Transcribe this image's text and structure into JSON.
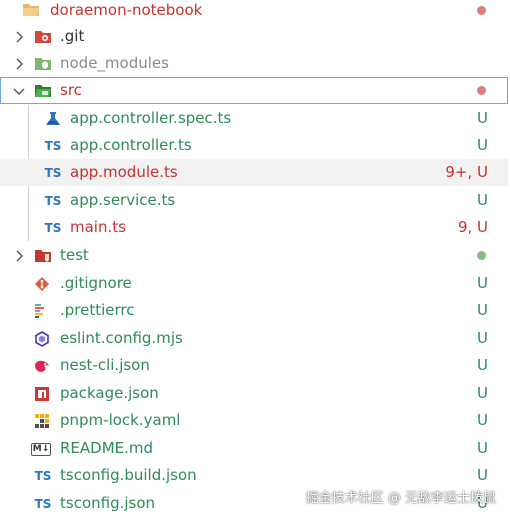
{
  "explorer": {
    "root": {
      "label": "doraemon-notebook"
    },
    "items": [
      {
        "label": ".git",
        "status": ""
      },
      {
        "label": "node_modules",
        "status": ""
      },
      {
        "label": "src",
        "status": ""
      },
      {
        "label": "app.controller.spec.ts",
        "status": "U"
      },
      {
        "label": "app.controller.ts",
        "status": "U"
      },
      {
        "label": "app.module.ts",
        "status": "9+, U"
      },
      {
        "label": "app.service.ts",
        "status": "U"
      },
      {
        "label": "main.ts",
        "status": "9, U"
      },
      {
        "label": "test",
        "status": ""
      },
      {
        "label": ".gitignore",
        "status": "U"
      },
      {
        "label": ".prettierrc",
        "status": "U"
      },
      {
        "label": "eslint.config.mjs",
        "status": "U"
      },
      {
        "label": "nest-cli.json",
        "status": "U"
      },
      {
        "label": "package.json",
        "status": "U"
      },
      {
        "label": "pnpm-lock.yaml",
        "status": "U"
      },
      {
        "label": "README.md",
        "status": "U"
      },
      {
        "label": "tsconfig.build.json",
        "status": "U"
      },
      {
        "label": "tsconfig.json",
        "status": "U"
      }
    ],
    "ts_badge": "TS",
    "md_badge": "M↓"
  },
  "colors": {
    "untracked": "#2e8b57",
    "error": "#c9302c",
    "modified_dot": "#e07b7b",
    "added_dot": "#7fbf7f",
    "ignored": "#8a8a8a"
  },
  "watermark": "掘金技术社区 @ 无敌李运士拨鼠"
}
